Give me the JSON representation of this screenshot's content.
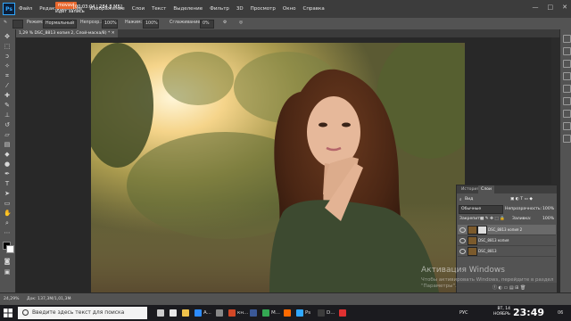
{
  "app": {
    "logo": "Ps",
    "title_dialog_placeholder": ""
  },
  "recorder": {
    "badge": "movavi",
    "label": "Идёт запись",
    "time": "[00:03:04 | 284.8 МБ]"
  },
  "menu": [
    "Файл",
    "Редактирование",
    "Изображение",
    "Слои",
    "Текст",
    "Выделение",
    "Фильтр",
    "3D",
    "Просмотр",
    "Окно",
    "Справка"
  ],
  "window_controls": [
    "—",
    "□",
    "✕"
  ],
  "options_bar": {
    "mode_label": "Режим:",
    "mode_value": "Нормальный",
    "opacity_label": "Непрозр.:",
    "opacity_value": "100%",
    "flow_label": "Нажим:",
    "flow_value": "100%",
    "smooth_label": "Сглаживание:",
    "smooth_value": "0%"
  },
  "document_tab": "DSC_8813 копия 2, Слой-маска/8) *",
  "zoom_tab_prefix": "1,29 % ",
  "status": {
    "zoom": "24,29%",
    "doc": "Док: 137,3M/1,01,3M"
  },
  "layers_panel": {
    "tabs": [
      "История",
      "Слои"
    ],
    "kind_label": "Вид",
    "blend_mode": "Обычные",
    "opacity_label": "Непрозрачность:",
    "opacity_value": "100%",
    "lock_label": "Закрепить:",
    "fill_label": "Заливка:",
    "fill_value": "100%",
    "layers": [
      {
        "name": "DSC_8813 копия 2",
        "selected": true,
        "has_mask": true
      },
      {
        "name": "DSC_8813 копия",
        "selected": false,
        "has_mask": false
      },
      {
        "name": "DSC_8813",
        "selected": false,
        "has_mask": false
      }
    ]
  },
  "watermark": {
    "title": "Активация Windows",
    "subtitle": "Чтобы активировать Windows, перейдите в раздел \"Параметры\"."
  },
  "taskbar": {
    "search_placeholder": "Введите здесь текст для поиска",
    "apps": [
      {
        "label": "",
        "color": "#cccccc"
      },
      {
        "label": "",
        "color": "#e8e8e8"
      },
      {
        "label": "",
        "color": "#f0c24b"
      },
      {
        "label": "A...",
        "color": "#2d8cff"
      },
      {
        "label": "",
        "color": "#888888"
      },
      {
        "label": "кн...",
        "color": "#d24726"
      },
      {
        "label": "",
        "color": "#3b5998"
      },
      {
        "label": "M...",
        "color": "#34a853"
      },
      {
        "label": "",
        "color": "#ff6a00"
      },
      {
        "label": "Ps",
        "color": "#31a8ff"
      },
      {
        "label": "D...",
        "color": "#3c3c3c"
      },
      {
        "label": "",
        "color": "#e03131"
      }
    ],
    "lang": "РУС",
    "date_line1": "ВТ, 14",
    "date_line2": "НОЯБРЬ",
    "time": "23:49",
    "notify": "06"
  },
  "colors": {
    "ui_bg": "#535353",
    "accent": "#31a8ff",
    "recorder": "#e8672d"
  }
}
